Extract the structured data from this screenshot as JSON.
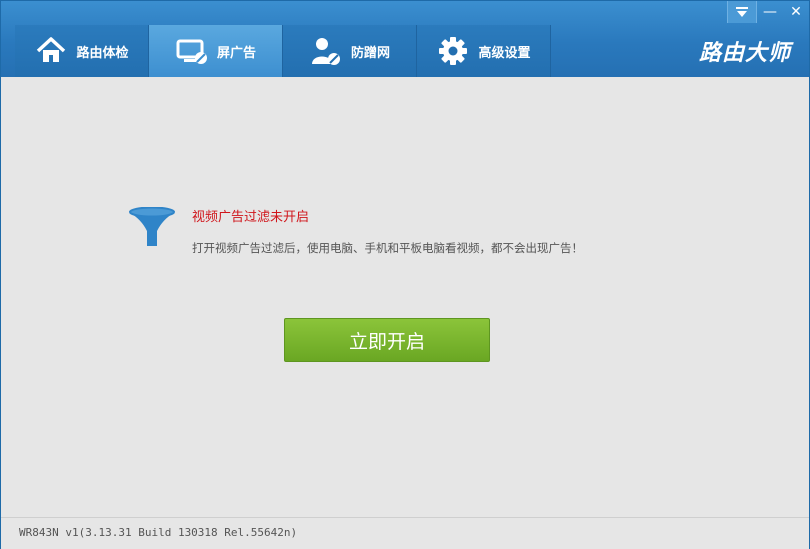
{
  "window": {
    "menu_icon": "dropdown-arrow-icon",
    "minimize_glyph": "—",
    "close_glyph": "✕"
  },
  "tabs": [
    {
      "label": "路由体检",
      "icon": "home-icon"
    },
    {
      "label": "屏广告",
      "icon": "monitor-block-icon"
    },
    {
      "label": "防蹭网",
      "icon": "user-block-icon"
    },
    {
      "label": "高级设置",
      "icon": "gear-icon"
    }
  ],
  "active_tab": 1,
  "brand": "路由大师",
  "main": {
    "icon": "funnel-icon",
    "title": "视频广告过滤未开启",
    "description": "打开视频广告过滤后，使用电脑、手机和平板电脑看视频，都不会出现广告！",
    "enable_button": "立即开启"
  },
  "status": {
    "version": "WR843N v1(3.13.31 Build 130318 Rel.55642n)"
  },
  "colors": {
    "header": "#2a79bd",
    "active_tab": "#4b9ad6",
    "warning_text": "#d0151b",
    "button": "#7ab52e",
    "funnel": "#2f84c8"
  }
}
